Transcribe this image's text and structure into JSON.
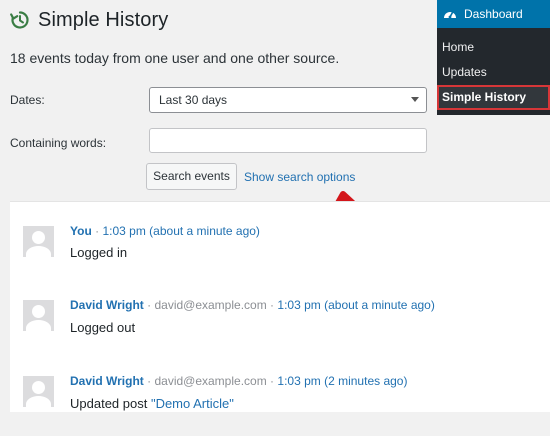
{
  "header": {
    "title": "Simple History",
    "summary": "18 events today from one user and one other source."
  },
  "filters": {
    "dates_label": "Dates:",
    "dates_value": "Last 30 days",
    "words_label": "Containing words:",
    "words_value": "",
    "search_button": "Search events",
    "search_options_link": "Show search options"
  },
  "events": [
    {
      "user": "You",
      "email": "",
      "time": "1:03 pm",
      "relative": "(about a minute ago)",
      "message": "Logged in",
      "message_link": ""
    },
    {
      "user": "David Wright",
      "email": "david@example.com",
      "time": "1:03 pm",
      "relative": "(about a minute ago)",
      "message": "Logged out",
      "message_link": ""
    },
    {
      "user": "David Wright",
      "email": "david@example.com",
      "time": "1:03 pm",
      "relative": "(2 minutes ago)",
      "message": "Updated post ",
      "message_link": "\"Demo Article\""
    }
  ],
  "admin_menu": {
    "header": "Dashboard",
    "items": [
      "Home",
      "Updates",
      "Simple History"
    ],
    "highlight_color": "#d63638",
    "accent_color": "#0073aa"
  },
  "icons": {
    "history": "history-icon",
    "dashboard": "gauge-icon",
    "arrow": "red-arrow-annotation"
  },
  "separators": {
    "dot": "·"
  }
}
